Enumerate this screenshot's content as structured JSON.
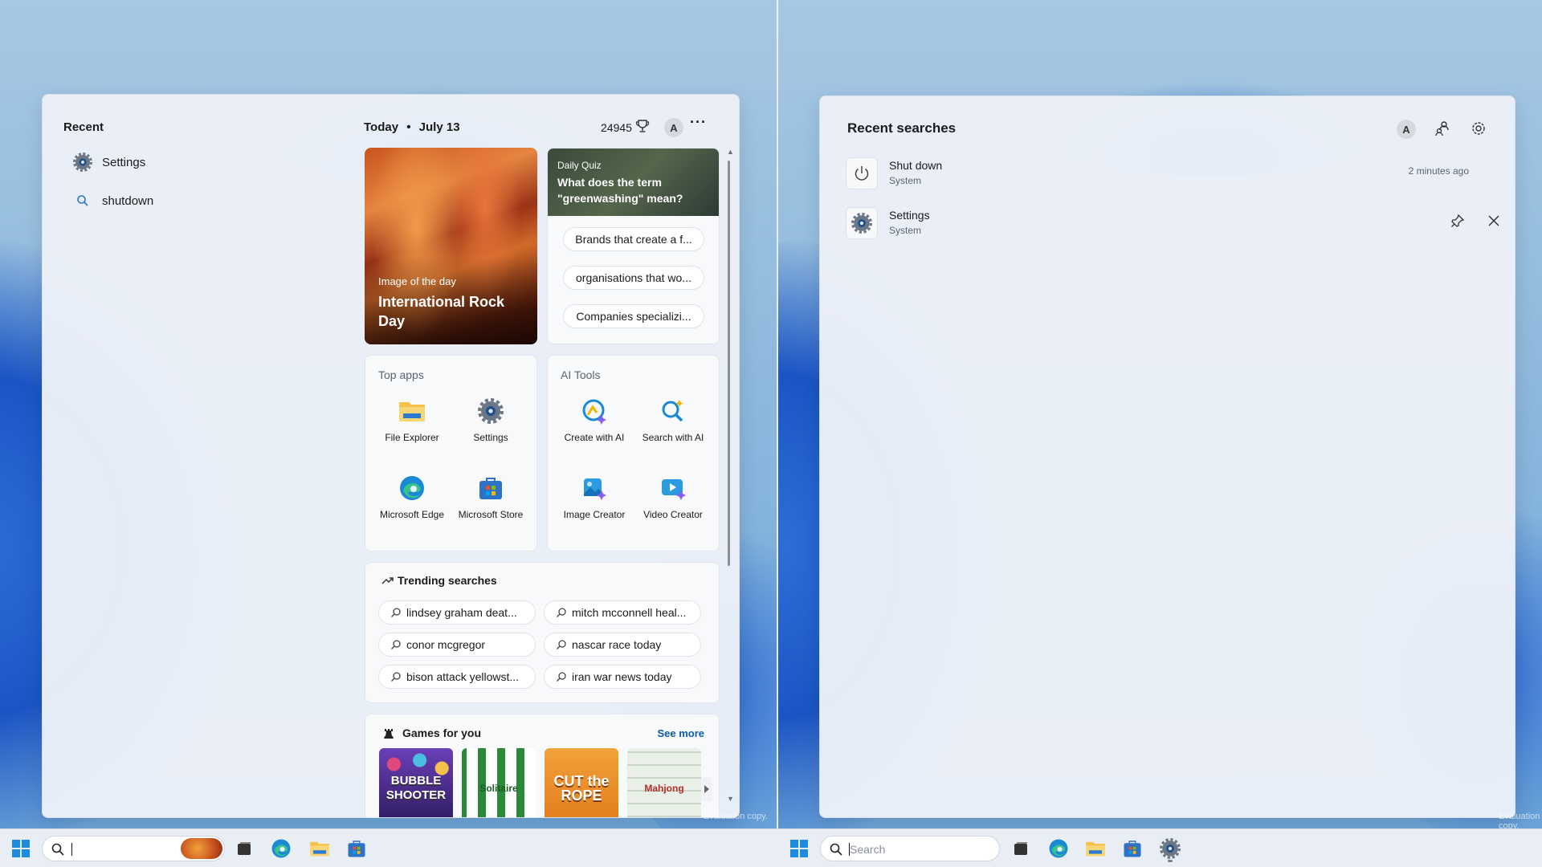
{
  "left_panel": {
    "recent_label": "Recent",
    "recent_items": [
      {
        "label": "Settings",
        "icon": "gear-icon"
      },
      {
        "label": "shutdown",
        "icon": "search-icon"
      }
    ],
    "date_label": "Today",
    "date_sep": "•",
    "date_value": "July 13",
    "points": "24945",
    "avatar_letter": "A",
    "more_label": "···",
    "image_of_day": {
      "kicker": "Image of the day",
      "title": "International Rock Day"
    },
    "quiz": {
      "kicker": "Daily Quiz",
      "question": "What does the term \"greenwashing\" mean?",
      "answers": [
        "Brands that create a f...",
        "organisations that wo...",
        "Companies specializi..."
      ]
    },
    "top_apps": {
      "label": "Top apps",
      "apps": [
        "File Explorer",
        "Settings",
        "Microsoft Edge",
        "Microsoft Store"
      ]
    },
    "ai_tools": {
      "label": "AI Tools",
      "tools": [
        "Create with AI",
        "Search with AI",
        "Image Creator",
        "Video Creator"
      ]
    },
    "trending": {
      "title": "Trending searches",
      "items": [
        "lindsey graham deat...",
        "mitch mcconnell heal...",
        "conor mcgregor",
        "nascar race today",
        "bison attack yellowst...",
        "iran war news today"
      ]
    },
    "games": {
      "title": "Games for you",
      "see_more": "See more",
      "items": [
        "BUBBLE SHOOTER",
        "Solitaire",
        "CUT the ROPE",
        "Mahjong"
      ]
    }
  },
  "right_panel": {
    "title": "Recent searches",
    "avatar_letter": "A",
    "items": [
      {
        "name": "Shut down",
        "sub": "System",
        "time": "2 minutes ago"
      },
      {
        "name": "Settings",
        "sub": "System"
      }
    ]
  },
  "taskbar_right": {
    "search_placeholder": "Search"
  },
  "watermark": "Evaluation copy.",
  "colors": {
    "accent": "#0b5cad",
    "edge_blue": "#1a8ad6",
    "folder_yellow": "#f4c24a"
  }
}
